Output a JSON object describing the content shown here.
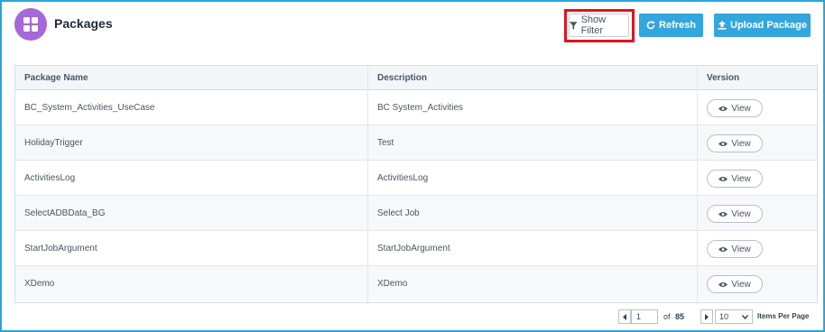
{
  "header": {
    "title": "Packages",
    "show_filter_label": "Show Filter",
    "refresh_label": "Refresh",
    "upload_label": "Upload Package"
  },
  "table": {
    "columns": [
      "Package Name",
      "Description",
      "Version"
    ],
    "rows": [
      {
        "name": "BC_System_Activities_UseCase",
        "description": "BC System_Activities",
        "action": "View"
      },
      {
        "name": "HolidayTrigger",
        "description": "Test",
        "action": "View"
      },
      {
        "name": "ActivitiesLog",
        "description": "ActivitiesLog",
        "action": "View"
      },
      {
        "name": "SelectADBData_BG",
        "description": "Select Job",
        "action": "View"
      },
      {
        "name": "StartJobArgument",
        "description": "StartJobArgument",
        "action": "View"
      },
      {
        "name": "XDemo",
        "description": "XDemo",
        "action": "View"
      }
    ]
  },
  "pagination": {
    "current_page": "1",
    "of_label": "of",
    "total_pages": "85",
    "per_page": "10",
    "per_page_label": "Items Per Page"
  },
  "colors": {
    "accent": "#33a6dd",
    "logo": "#a468d8",
    "highlight": "#e0141e",
    "frame": "#29a3dc"
  },
  "icons": {
    "logo": "grid-icon",
    "filter": "filter-icon",
    "refresh": "refresh-icon",
    "upload": "upload-icon",
    "view": "eye-icon",
    "prev": "chevron-left-icon",
    "next": "chevron-right-icon",
    "dropdown": "chevron-down-icon"
  }
}
